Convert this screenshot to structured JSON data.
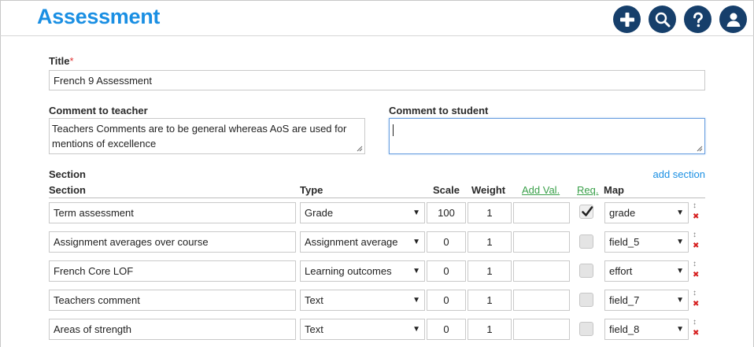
{
  "page": {
    "title": "Assessment"
  },
  "form": {
    "title_label": "Title",
    "title_required_mark": "*",
    "title_value": "French 9 Assessment",
    "comment_teacher_label": "Comment to teacher",
    "comment_teacher_value": "Teachers Comments are to be general whereas AoS are used for mentions of excellence",
    "comment_student_label": "Comment to student",
    "comment_student_value": ""
  },
  "sections": {
    "heading": "Section",
    "add_label": "add section",
    "columns": {
      "section": "Section",
      "type": "Type",
      "scale": "Scale",
      "weight": "Weight",
      "add_val": "Add Val.",
      "req": "Req.",
      "map": "Map"
    },
    "rows": [
      {
        "name": "Term assessment",
        "type": "Grade",
        "scale": "100",
        "weight": "1",
        "add_val": "",
        "required": true,
        "map": "grade"
      },
      {
        "name": "Assignment averages over course",
        "type": "Assignment average",
        "scale": "0",
        "weight": "1",
        "add_val": "",
        "required": false,
        "map": "field_5"
      },
      {
        "name": "French Core LOF",
        "type": "Learning outcomes",
        "scale": "0",
        "weight": "1",
        "add_val": "",
        "required": false,
        "map": "effort"
      },
      {
        "name": "Teachers comment",
        "type": "Text",
        "scale": "0",
        "weight": "1",
        "add_val": "",
        "required": false,
        "map": "field_7"
      },
      {
        "name": "Areas of strength",
        "type": "Text",
        "scale": "0",
        "weight": "1",
        "add_val": "",
        "required": false,
        "map": "field_8"
      }
    ]
  },
  "icons": {
    "header": [
      "plus-icon",
      "search-icon",
      "help-icon",
      "user-icon"
    ],
    "row_move": "move-icon",
    "row_delete": "delete-icon",
    "select_arrow": "▼"
  },
  "colors": {
    "brand": "#1a8fe3",
    "header_button": "#163f6b",
    "link_green": "#3aa04a",
    "delete_red": "#d62020"
  }
}
